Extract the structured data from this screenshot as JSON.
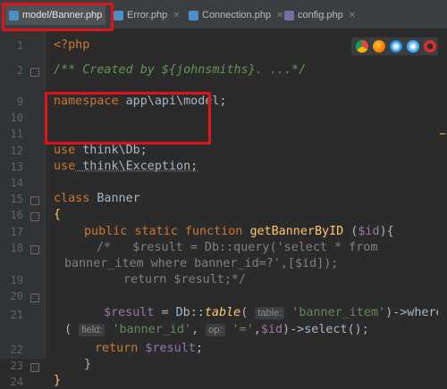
{
  "tabs": [
    {
      "label": "model/Banner.php",
      "active": true
    },
    {
      "label": "Error.php"
    },
    {
      "label": "Connection.php"
    },
    {
      "label": "config.php"
    }
  ],
  "gutter": {
    "lines": [
      "1",
      "2",
      "9",
      "10",
      "11",
      "12",
      "13",
      "14",
      "15",
      "16",
      "17",
      "18",
      "",
      "19",
      "20",
      "21",
      "",
      "22",
      "23",
      "24"
    ]
  },
  "code": {
    "l1": "<?php",
    "l2_comment": "/** Created by ${johnsmiths}. ...*/",
    "l9_kw": "namespace",
    "l9_rest": " app\\api\\model;",
    "l12_kw": "use",
    "l12_rest": " think\\Db;",
    "l13_kw": "use",
    "l13_rest": " think\\Exception;",
    "l15_kw": "class",
    "l15_rest": " Banner",
    "l16": "{",
    "l17_kw": "public static function",
    "l17_fn": "getBannerByID",
    "l17_open": " (",
    "l17_var": "$id",
    "l17_close": "){",
    "l18a": "/*   $result = Db::query('select * from",
    "l18b": "banner_item where banner_id=?',[$id]);",
    "l19": "return $result;*/",
    "l21_var": "$result",
    "l21_eq": " = Db::",
    "l21_fn": "table",
    "l21_paren": "(",
    "l21_hint": "table:",
    "l21_str": "'banner_item'",
    "l21_rest": ")->where",
    "l21b_open": "(",
    "l21b_hint1": "field:",
    "l21b_str1": "'banner_id'",
    "l21b_comma": ",",
    "l21b_hint2": "op:",
    "l21b_str2": "'='",
    "l21b_rest1": ",",
    "l21b_var": "$id",
    "l21b_rest2": ")->select();",
    "l22_kw": "return",
    "l22_var": "$result",
    "l22_end": ";",
    "l23": "}",
    "l24": "}"
  },
  "colors": {
    "highlight": "#e0121c",
    "browser_icons": [
      "#e8453c",
      "#ff9500",
      "#1e88e5",
      "#3fa9f5",
      "#d32f2f"
    ]
  },
  "icons": [
    "chrome-icon",
    "firefox-icon",
    "safari-icon",
    "edge-icon",
    "opera-icon"
  ]
}
